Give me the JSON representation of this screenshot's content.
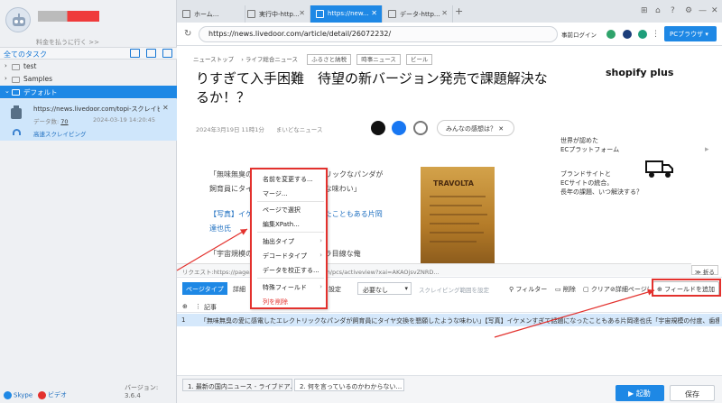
{
  "left": {
    "upgrade": "料金を払うに行く >>",
    "all_tasks": "全てのタスク",
    "folders": [
      {
        "label": "test",
        "arrow": "›"
      },
      {
        "label": "Samples",
        "arrow": "›"
      },
      {
        "label": "デフォルト",
        "arrow": "⌄"
      }
    ],
    "task": {
      "url": "https://news.livedoor.com/topi-スクレイピン...",
      "data_label": "データ数:",
      "count": "70",
      "time": "2024-03-19 14:20:45",
      "fast": "高速スクレイピング",
      "close": "✕"
    },
    "skype": "Skype",
    "video": "ビデオ",
    "version": "バージョン: 3.6.4"
  },
  "tabs": [
    {
      "label": "ホーム..."
    },
    {
      "label": "実行中-http..."
    },
    {
      "label": "https://new..."
    },
    {
      "label": "データ-http..."
    }
  ],
  "addr": {
    "url": "https://news.livedoor.com/article/detail/26072232/",
    "login": "事前ログイン",
    "browser": "PCブラウザ"
  },
  "page": {
    "crumbs": [
      "ニューストップ",
      "ライフ総合ニュース"
    ],
    "crumb_btns": [
      "ふるさと納税",
      "時事ニュース",
      "ビール"
    ],
    "headline": "りすぎて入手困難　待望の新バージョン発売で課題解決なるか！？",
    "date": "2024年3月19日 11時1分　　まいどなニュース",
    "react": "みんなの感想は？",
    "para1a": "「無味無臭の愛に感電したエレクトリックなパンダが",
    "para1b": "飼育員にタイヤ交換を懇願したような味わい」",
    "link1a": "【写真】イケメンすぎて話題になったこともある片岡",
    "link1b": "達也氏",
    "para2": "「宇宙規模の付度、歯痩せてもカメラ目線な俺",
    "photo_label": "TRAVOLTA",
    "shopify": "shopify plus",
    "ad1": "世界が認めた\nECプラットフォーム",
    "ad2": "ブランドサイトと\nECサイトの統合。\n長年の課題、いつ解決する？",
    "fold": "折る"
  },
  "req": "リクエスト:https://pagead2.googlesyndication.com/pcs/activeview?xai=AKAOjsvZNRD...",
  "toolbar": {
    "page_type": "ページタイプ",
    "detail": "詳細",
    "setting": "設定",
    "select": "必要なし",
    "scroll": "スクレイピング範囲を設定",
    "filter": "フィルター",
    "delete": "削除",
    "clear": "クリア",
    "detail_page": "詳細ページに行く",
    "add_field": "フィールドを追加"
  },
  "grid": {
    "header": "記事",
    "rows": [
      {
        "n": "1",
        "c": "「無味無臭の愛に感電したエレクトリックなパンダが飼育員にタイヤ交換を懇願したような味わい」【写真】イケメンすぎて話題になったこともある片岡達也氏「宇宙規模の付度、歯痩せ..."
      }
    ]
  },
  "pages": [
    "1. 最新の国内ニュース - ライブドア...",
    "2. 何を言っているのかわからない..."
  ],
  "start": "起動",
  "save": "保存",
  "menu": [
    {
      "label": "名前を変更する..."
    },
    {
      "label": "マージ..."
    },
    {
      "label": "ページで選択"
    },
    {
      "label": "編集XPath..."
    },
    {
      "label": "抽出タイプ"
    },
    {
      "label": "デコードタイプ"
    },
    {
      "label": "データを校正する..."
    },
    {
      "label": "特殊フィールド"
    },
    {
      "label": "列を削除"
    }
  ],
  "colors": {
    "accent": "#1e88e5",
    "highlight": "#e3312d"
  }
}
